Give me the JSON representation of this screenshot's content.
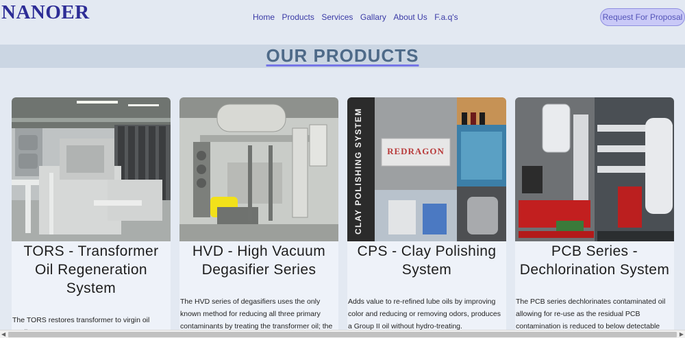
{
  "brand": {
    "logo": "NANOER"
  },
  "nav": {
    "items": [
      "Home",
      "Products",
      "Services",
      "Gallary",
      "About Us",
      "F.a.q's"
    ],
    "cta": "Request For Proposal"
  },
  "section": {
    "title": "OUR PRODUCTS"
  },
  "products": [
    {
      "title": "TORS - Transformer Oil Regeneration System",
      "description": "The TORS restores transformer to virgin oil quality..."
    },
    {
      "title": "HVD - High Vacuum Degasifier Series",
      "description": "The HVD series of degasifiers uses the only known method for reducing all three primary contaminants by treating the transformer oil; the"
    },
    {
      "title": "CPS - Clay Polishing System",
      "description": "Adds value to re-refined lube oils by improving color and reducing or removing odors, produces a Group II oil without hydro-treating."
    },
    {
      "title": "PCB Series - Dechlorination System",
      "description": "The PCB series dechlorinates contaminated oil allowing for re-use as the residual PCB contamination is reduced to below detectable"
    }
  ],
  "images": {
    "cps_sign": "REDRAGON",
    "cps_side_text": "CLAY POLISHING SYSTEM"
  }
}
